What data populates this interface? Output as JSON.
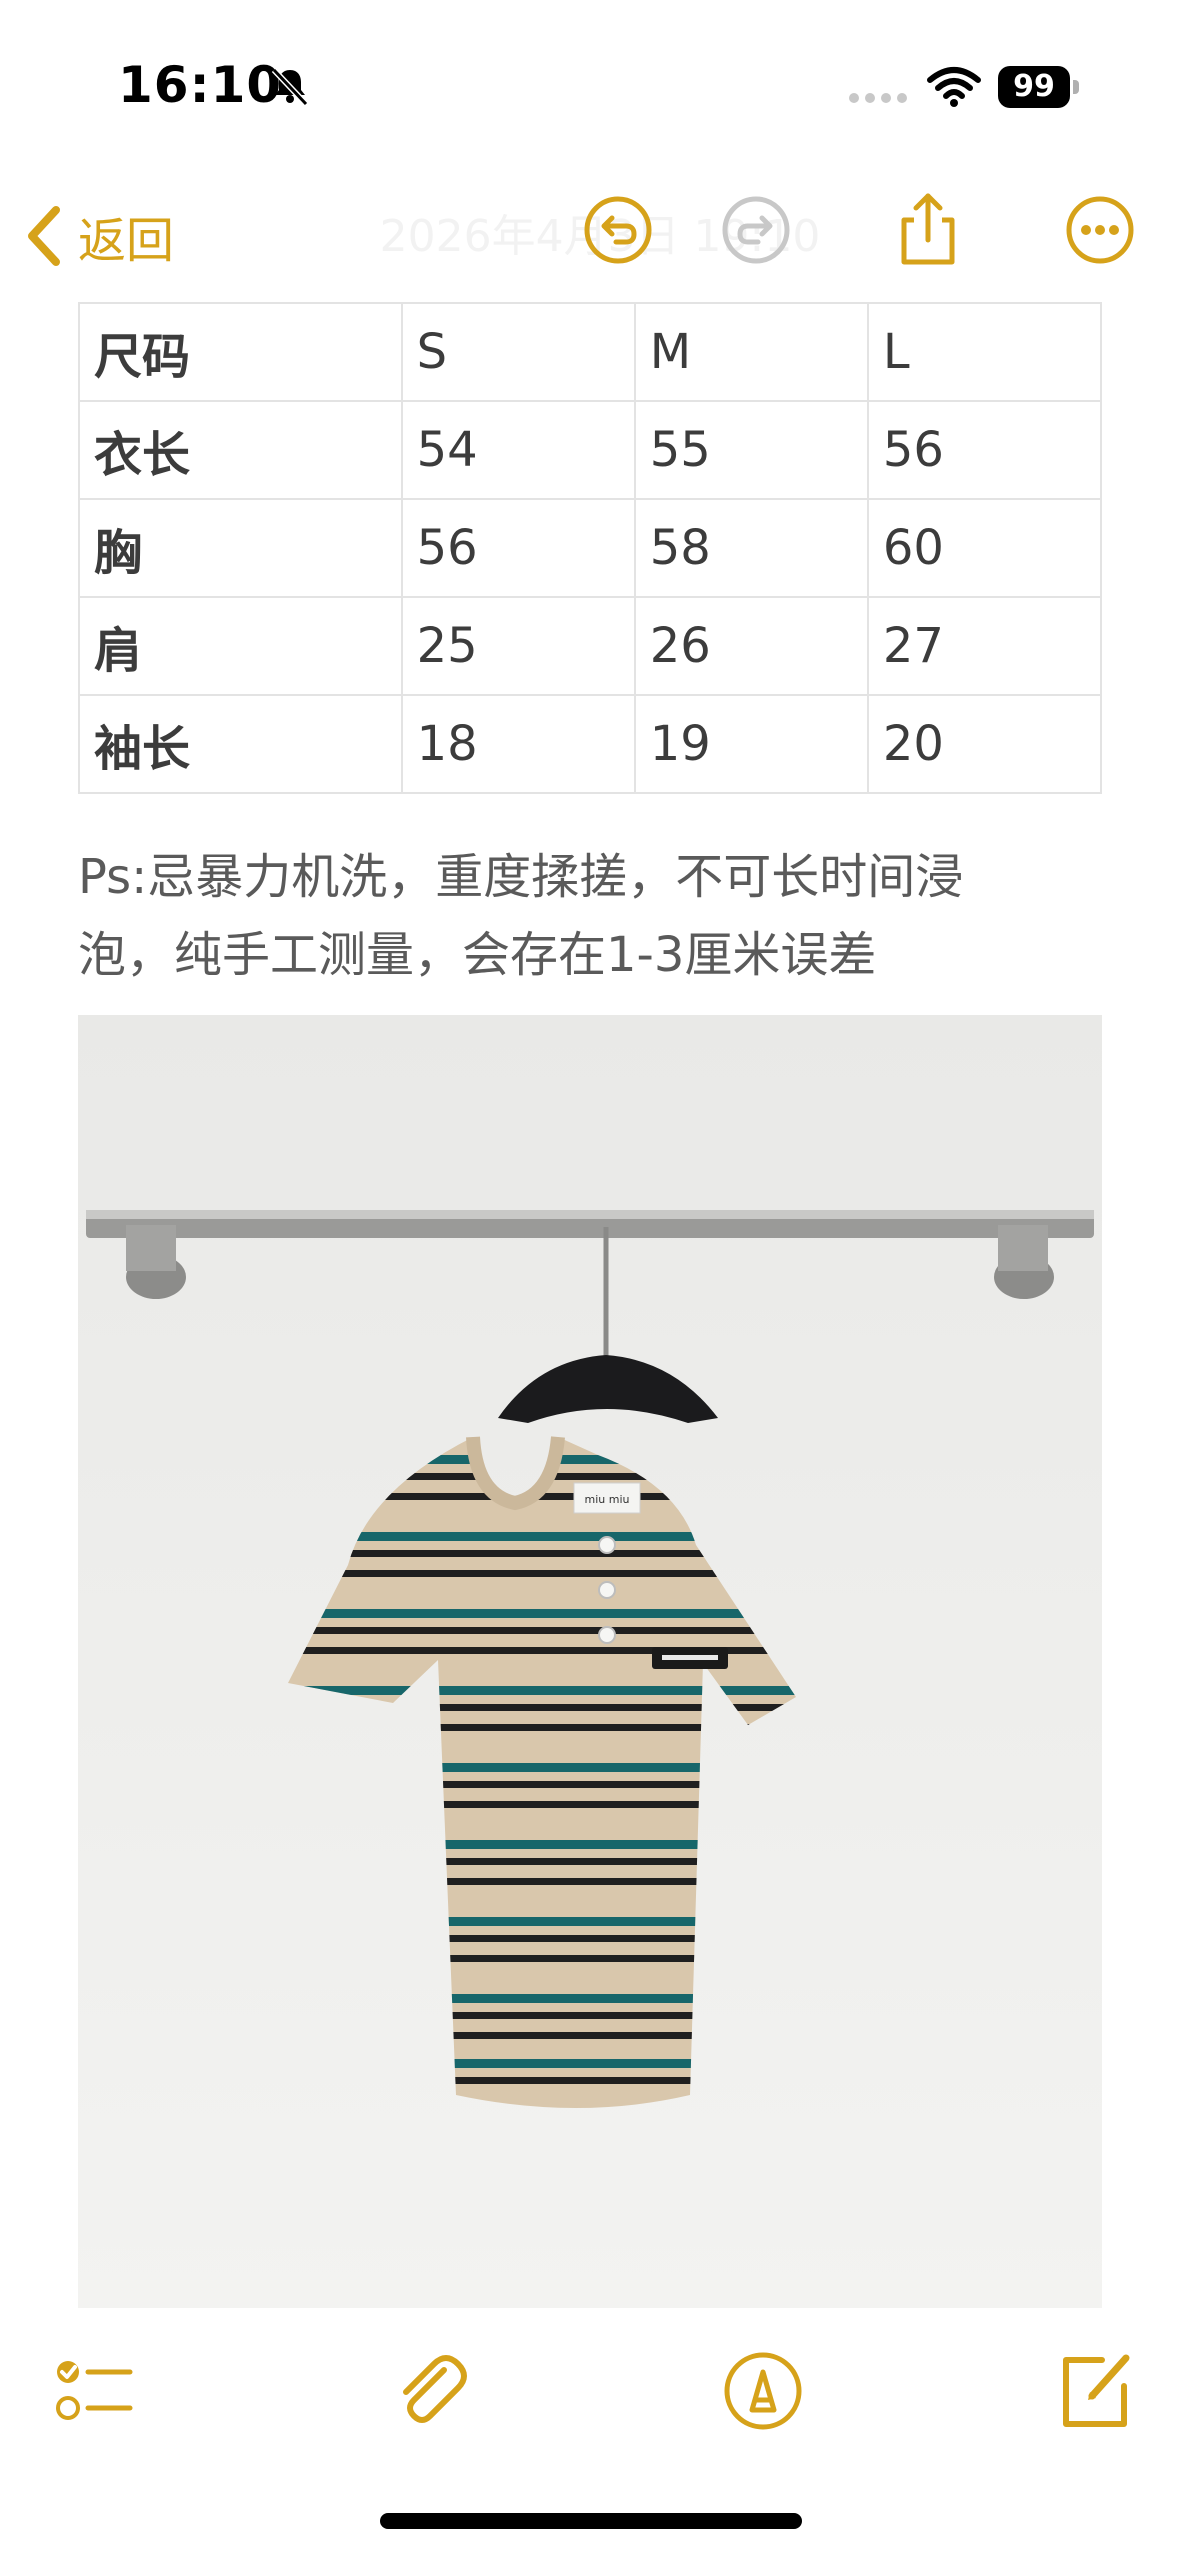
{
  "status": {
    "time": "16:10",
    "battery": "99"
  },
  "nav": {
    "back_label": "返回",
    "title": "2026年4月3日 19:10"
  },
  "size_table": {
    "rows": [
      [
        "尺码",
        "S",
        "M",
        "L"
      ],
      [
        "衣长",
        "54",
        "55",
        "56"
      ],
      [
        "胸",
        "56",
        "58",
        "60"
      ],
      [
        "肩",
        "25",
        "26",
        "27"
      ],
      [
        "袖长",
        "18",
        "19",
        "20"
      ]
    ]
  },
  "note": {
    "line1": "Ps:忌暴力机洗，重度揉搓，不可长时间浸",
    "line2": "泡，纯手工测量，会存在1-3厘米误差"
  },
  "photo": {
    "alt": "striped knit short-sleeve top on hanger",
    "label_text": "miu miu",
    "colors": {
      "base": "#d9c7ac",
      "green": "#17666a",
      "black": "#1f1f1f"
    }
  },
  "colors": {
    "accent": "#d6a21a",
    "table_border": "#e3e3e3"
  },
  "icons": {
    "back": "chevron-left-icon",
    "undo": "undo-icon",
    "redo": "redo-icon",
    "share": "share-icon",
    "more": "more-icon",
    "checklist": "checklist-icon",
    "attachment": "paperclip-icon",
    "markup": "markup-pen-icon",
    "compose": "compose-icon"
  }
}
